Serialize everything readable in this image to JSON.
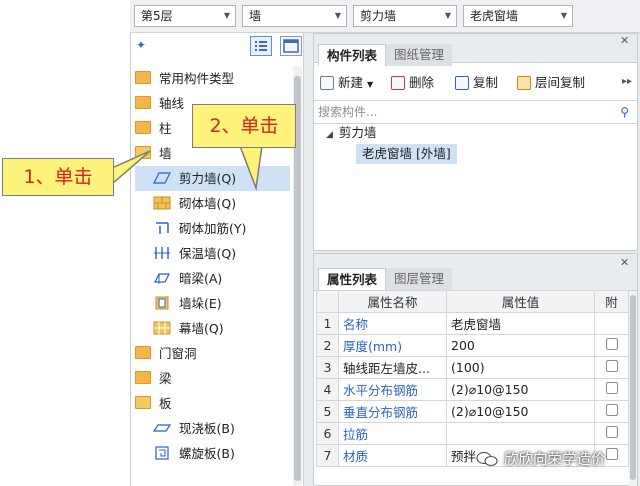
{
  "selects": [
    {
      "value": "第5层"
    },
    {
      "value": "墙"
    },
    {
      "value": "剪力墙"
    },
    {
      "value": "老虎窗墙"
    }
  ],
  "tree": {
    "items": [
      {
        "label": "常用构件类型"
      },
      {
        "label": "轴线"
      },
      {
        "label": "柱"
      },
      {
        "label": "墙"
      },
      {
        "label": "剪力墙(Q)"
      },
      {
        "label": "砌体墙(Q)"
      },
      {
        "label": "砌体加筋(Y)"
      },
      {
        "label": "保温墙(Q)"
      },
      {
        "label": "暗梁(A)"
      },
      {
        "label": "墙垛(E)"
      },
      {
        "label": "幕墙(Q)"
      },
      {
        "label": "门窗洞"
      },
      {
        "label": "梁"
      },
      {
        "label": "板"
      },
      {
        "label": "现浇板(B)"
      },
      {
        "label": "螺旋板(B)"
      }
    ]
  },
  "component_panel": {
    "tabs": [
      "构件列表",
      "图纸管理"
    ],
    "toolbar": {
      "new": "新建",
      "delete": "删除",
      "copy": "复制",
      "floor_copy": "层间复制"
    },
    "search_placeholder": "搜索构件...",
    "group": "剪力墙",
    "item": "老虎窗墙 [外墙]"
  },
  "prop_panel": {
    "tabs": [
      "属性列表",
      "图层管理"
    ],
    "headers": {
      "name": "属性名称",
      "value": "属性值",
      "add": "附"
    },
    "rows": [
      {
        "idx": "1",
        "name": "名称",
        "value": "老虎窗墙",
        "blue": true
      },
      {
        "idx": "2",
        "name": "厚度(mm)",
        "value": "200",
        "blue": true
      },
      {
        "idx": "3",
        "name": "轴线距左墙皮...",
        "value": "(100)",
        "blue": false
      },
      {
        "idx": "4",
        "name": "水平分布钢筋",
        "value": "(2)⌀10@150",
        "blue": true
      },
      {
        "idx": "5",
        "name": "垂直分布钢筋",
        "value": "(2)⌀10@150",
        "blue": true
      },
      {
        "idx": "6",
        "name": "拉筋",
        "value": "",
        "blue": true
      },
      {
        "idx": "7",
        "name": "材质",
        "value": "预拌...",
        "blue": true
      }
    ]
  },
  "callouts": {
    "first": "1、单击",
    "second": "2、单击"
  },
  "watermark": "欣欣向荣学造价",
  "colors": {
    "callout_bg": "#fdf27a",
    "callout_text": "#d6221e",
    "selection": "#cfe1f5",
    "property_blue": "#2a62c9"
  }
}
